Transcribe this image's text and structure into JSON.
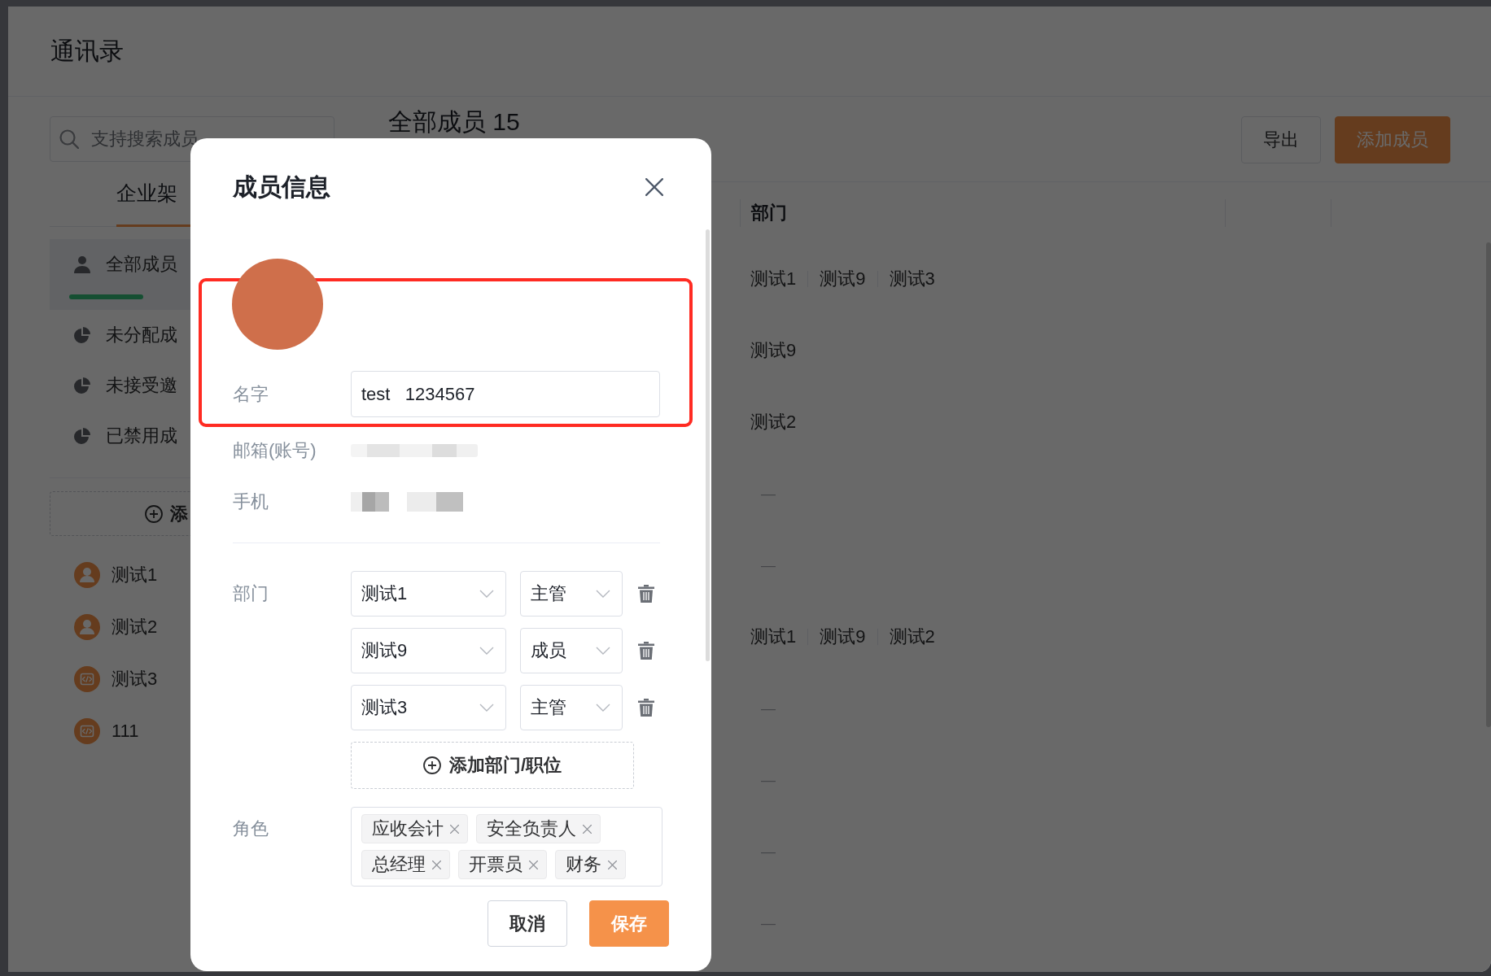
{
  "page": {
    "title": "通讯录"
  },
  "search": {
    "placeholder": "支持搜索成员"
  },
  "tabs": [
    {
      "label": "企业架",
      "selected": true
    }
  ],
  "member_filters": [
    {
      "label": "全部成员",
      "kind": "person",
      "selected": true
    },
    {
      "label": "未分配成",
      "kind": "pie",
      "selected": false
    },
    {
      "label": "未接受邀",
      "kind": "pie",
      "selected": false
    },
    {
      "label": "已禁用成",
      "kind": "pie",
      "selected": false
    }
  ],
  "add_department_button": {
    "label": "添"
  },
  "departments": [
    {
      "name": "测试1",
      "kind": "person"
    },
    {
      "name": "测试2",
      "kind": "person"
    },
    {
      "name": "测试3",
      "kind": "code"
    },
    {
      "name": "111",
      "kind": "code"
    }
  ],
  "member_list": {
    "title": "全部成员 15",
    "buttons": [
      {
        "label": "导出",
        "kind": "secondary"
      },
      {
        "label": "添加成员",
        "kind": "primary"
      }
    ]
  },
  "table": {
    "columns": [
      "部门"
    ],
    "rows": [
      {
        "kind": "names",
        "names": [
          "测试1",
          "测试9",
          "测试3"
        ]
      },
      {
        "kind": "names",
        "names": [
          "测试9"
        ]
      },
      {
        "kind": "names",
        "names": [
          "测试2"
        ]
      },
      {
        "kind": "empty",
        "text": "—"
      },
      {
        "kind": "empty",
        "text": "—"
      },
      {
        "kind": "names",
        "names": [
          "测试1",
          "测试9",
          "测试2"
        ]
      },
      {
        "kind": "empty",
        "text": "—"
      },
      {
        "kind": "empty",
        "text": "—"
      },
      {
        "kind": "empty",
        "text": "—"
      },
      {
        "kind": "empty",
        "text": "—"
      }
    ]
  },
  "dialog": {
    "title": "成员信息",
    "fields": [
      {
        "label": "名字",
        "kind": "input",
        "value": "test   1234567"
      },
      {
        "label": "邮箱(账号)",
        "kind": "smudge"
      },
      {
        "label": "手机",
        "kind": "pixelated"
      }
    ],
    "department_label": "部门",
    "assignments": [
      {
        "department": "测试1",
        "position": "主管"
      },
      {
        "department": "测试9",
        "position": "成员"
      },
      {
        "department": "测试3",
        "position": "主管"
      }
    ],
    "add_assignment_button": {
      "label": "添加部门/职位"
    },
    "roles_label": "角色",
    "roles": [
      "应收会计",
      "安全负责人",
      "总经理",
      "开票员",
      "财务"
    ],
    "buttons": [
      {
        "label": "取消",
        "kind": "secondary"
      },
      {
        "label": "保存",
        "kind": "primary"
      }
    ]
  }
}
